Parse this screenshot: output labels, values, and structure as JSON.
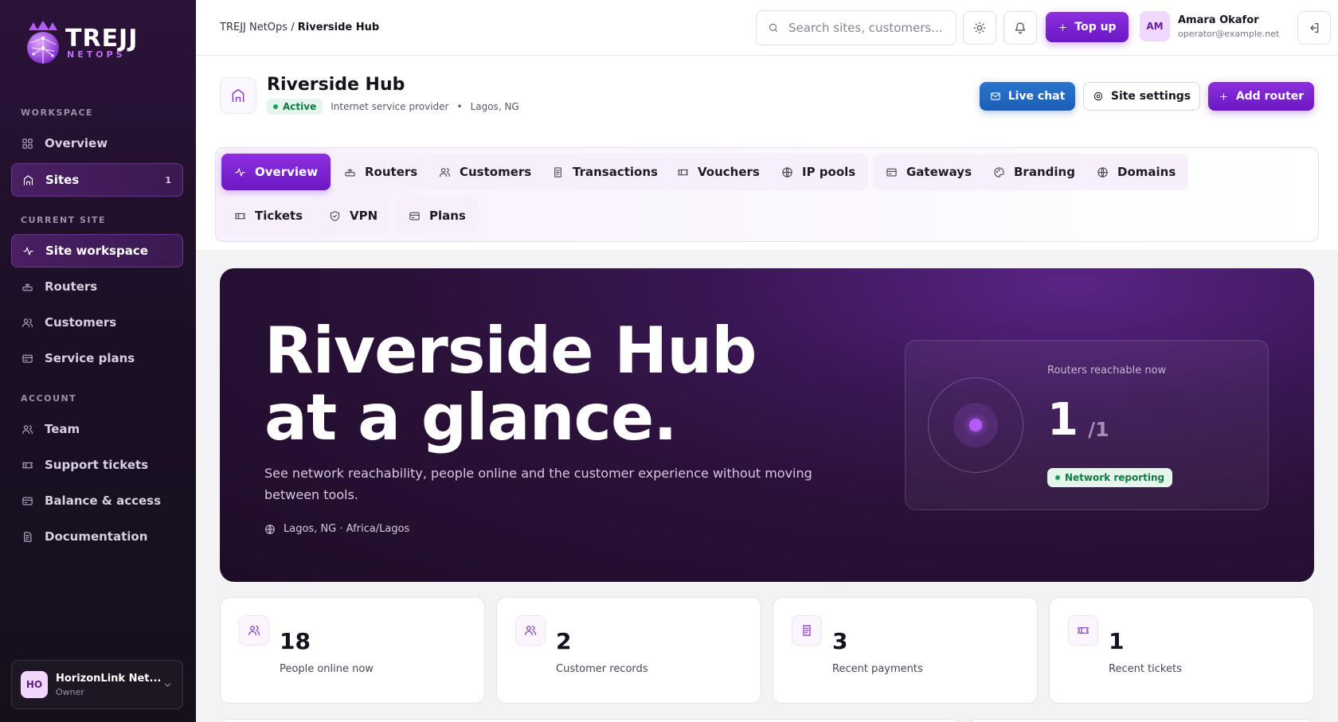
{
  "brand": {
    "name": "TREJJ",
    "sub": "NETOPS"
  },
  "sidebar": {
    "workspace_label": "WORKSPACE",
    "current_site_label": "CURRENT SITE",
    "account_label": "ACCOUNT",
    "items": [
      {
        "label": "Overview",
        "icon": "grid-icon"
      },
      {
        "label": "Sites",
        "icon": "building-icon",
        "badge": "1"
      },
      {
        "label": "Site workspace",
        "icon": "activity-icon"
      },
      {
        "label": "Routers",
        "icon": "router-icon"
      },
      {
        "label": "Customers",
        "icon": "users-icon"
      },
      {
        "label": "Service plans",
        "icon": "card-icon"
      },
      {
        "label": "Team",
        "icon": "users-icon"
      },
      {
        "label": "Support tickets",
        "icon": "ticket-icon"
      },
      {
        "label": "Balance & access",
        "icon": "card-icon"
      },
      {
        "label": "Documentation",
        "icon": "doc-icon"
      }
    ],
    "org": {
      "initials": "HO",
      "name": "HorizonLink Net...",
      "role": "Owner"
    }
  },
  "topbar": {
    "breadcrumb_root": "TREJJ NetOps",
    "breadcrumb_sep": "/",
    "breadcrumb_current": "Riverside Hub",
    "search_placeholder": "Search sites, customers...",
    "topup_label": "Top up",
    "user": {
      "initials": "AM",
      "name": "Amara Okafor",
      "email": "operator@example.net"
    }
  },
  "site": {
    "title": "Riverside Hub",
    "status": "Active",
    "type": "Internet service provider",
    "bullet": "•",
    "location": "Lagos, NG",
    "buttons": {
      "chat": "Live chat",
      "settings": "Site settings",
      "add": "Add router"
    }
  },
  "tabs": [
    {
      "label": "Overview",
      "icon": "activity-icon",
      "active": true
    },
    {
      "label": "Routers",
      "icon": "router-icon"
    },
    {
      "label": "Customers",
      "icon": "users-icon"
    },
    {
      "label": "Transactions",
      "icon": "receipt-icon"
    },
    {
      "label": "Vouchers",
      "icon": "ticket-icon"
    },
    {
      "label": "IP pools",
      "icon": "globe-icon"
    },
    {
      "label": "Gateways",
      "icon": "card-icon"
    },
    {
      "label": "Branding",
      "icon": "palette-icon"
    },
    {
      "label": "Domains",
      "icon": "globe-icon"
    },
    {
      "label": "Tickets",
      "icon": "ticket-icon"
    },
    {
      "label": "VPN",
      "icon": "shield-icon"
    },
    {
      "label": "Plans",
      "icon": "card-icon"
    }
  ],
  "hero": {
    "title": "Riverside Hub at a glance.",
    "subtitle": "See network reachability, people online and the customer experience without moving between tools.",
    "location": "Lagos, NG · Africa/Lagos",
    "reach_label": "Routers reachable now",
    "reach_value": "1",
    "reach_total": "/1",
    "reach_status": "Network reporting"
  },
  "stats": [
    {
      "value": "18",
      "label": "People online now",
      "icon": "users-icon"
    },
    {
      "value": "2",
      "label": "Customer records",
      "icon": "users-icon"
    },
    {
      "value": "3",
      "label": "Recent payments",
      "icon": "receipt-icon"
    },
    {
      "value": "1",
      "label": "Recent tickets",
      "icon": "ticket-icon"
    }
  ],
  "colors": {
    "accent": "#7b22d4",
    "sidebar_bg": "#1f1028",
    "success": "#16a05a",
    "chat": "#1f64bb"
  }
}
